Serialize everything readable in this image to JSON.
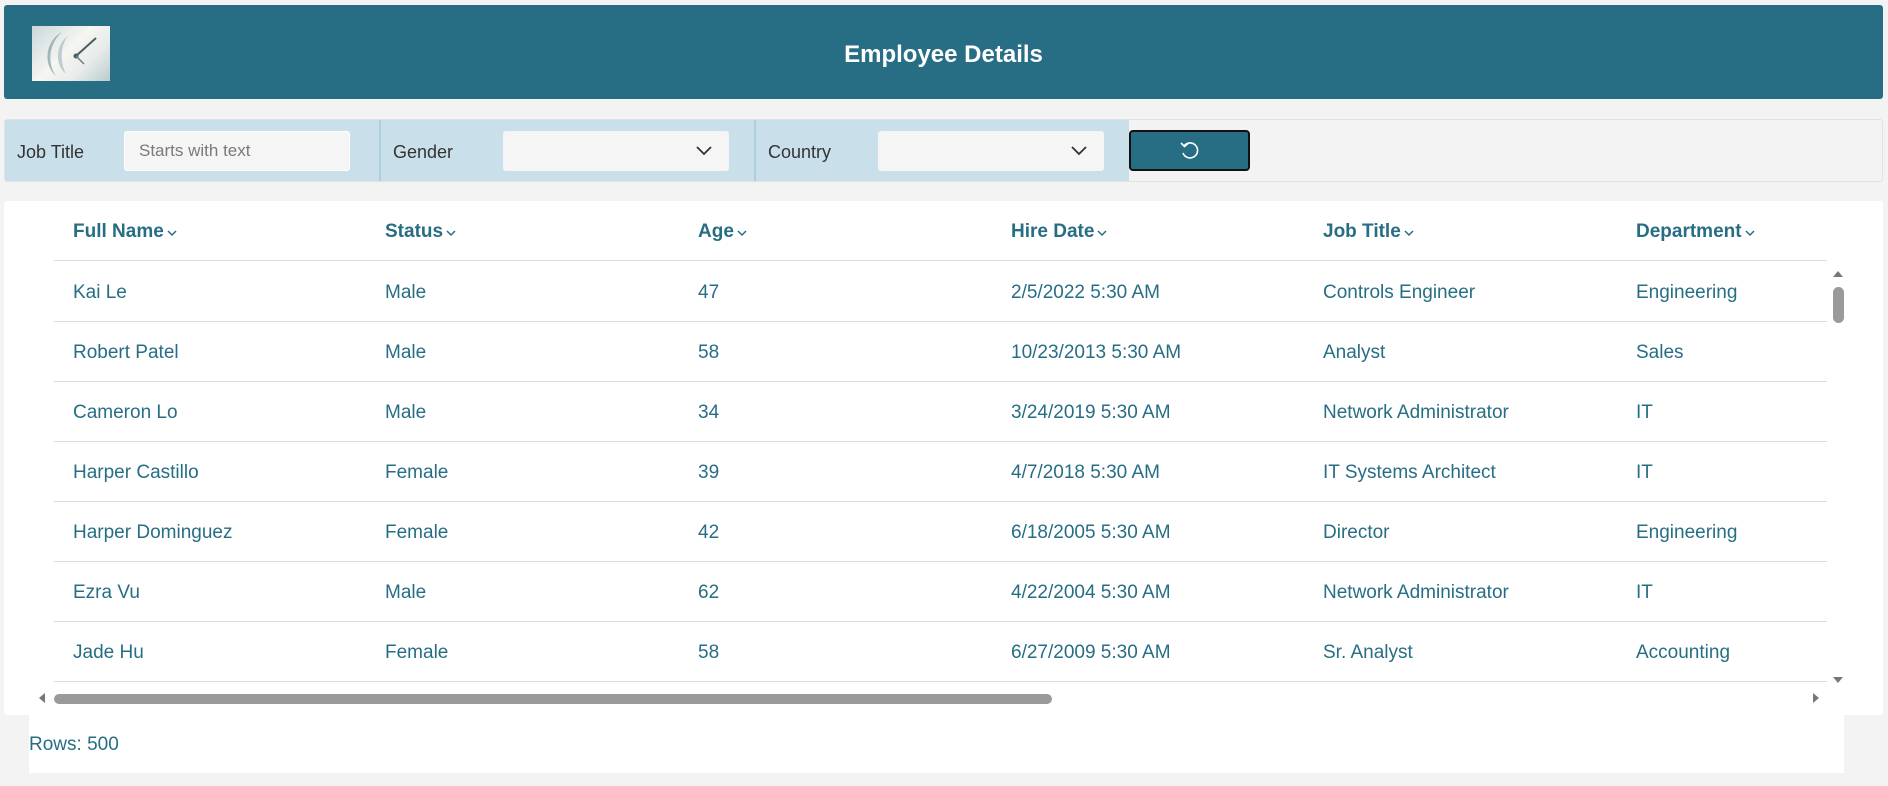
{
  "header": {
    "title": "Employee Details",
    "logo_icon": "clock-logo-icon"
  },
  "filters": {
    "job_title_label": "Job Title",
    "job_title_placeholder": "Starts with text",
    "job_title_value": "",
    "gender_label": "Gender",
    "gender_value": "",
    "country_label": "Country",
    "country_value": "",
    "reset_icon": "undo-icon"
  },
  "grid": {
    "columns": [
      "Full Name",
      "Status",
      "Age",
      "Hire Date",
      "Job Title",
      "Department"
    ],
    "rows": [
      [
        "Kai Le",
        "Male",
        "47",
        "2/5/2022 5:30 AM",
        "Controls Engineer",
        "Engineering"
      ],
      [
        "Robert Patel",
        "Male",
        "58",
        "10/23/2013 5:30 AM",
        "Analyst",
        "Sales"
      ],
      [
        "Cameron Lo",
        "Male",
        "34",
        "3/24/2019 5:30 AM",
        "Network Administrator",
        "IT"
      ],
      [
        "Harper Castillo",
        "Female",
        "39",
        "4/7/2018 5:30 AM",
        "IT Systems Architect",
        "IT"
      ],
      [
        "Harper Dominguez",
        "Female",
        "42",
        "6/18/2005 5:30 AM",
        "Director",
        "Engineering"
      ],
      [
        "Ezra Vu",
        "Male",
        "62",
        "4/22/2004 5:30 AM",
        "Network Administrator",
        "IT"
      ],
      [
        "Jade Hu",
        "Female",
        "58",
        "6/27/2009 5:30 AM",
        "Sr. Analyst",
        "Accounting"
      ]
    ]
  },
  "footer": {
    "rows_text": "Rows: 500"
  },
  "colors": {
    "accent": "#276e85",
    "filter_bg": "#c9e0ea",
    "page_bg": "#f3f3f3"
  }
}
